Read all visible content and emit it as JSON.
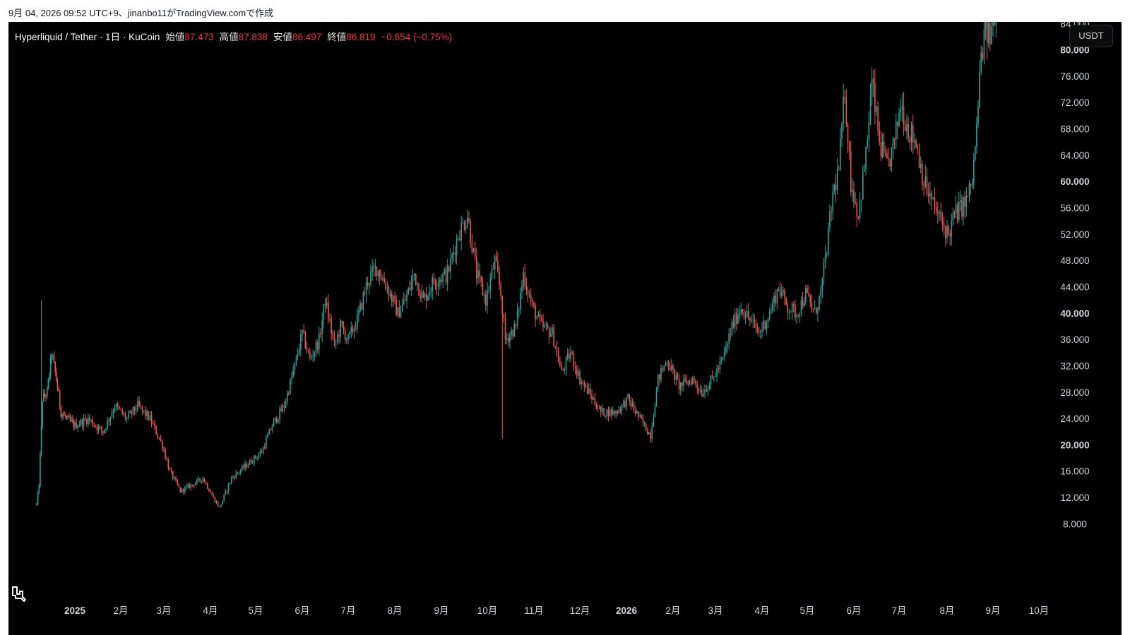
{
  "caption": "9月 04, 2026 09:52 UTC+9、jinanbo11がTradingView.comで作成",
  "legend": {
    "symbol": "Hyperliquid / Tether · 1日 · KuCoin",
    "open_label": "始値",
    "open": "87.473",
    "high_label": "高値",
    "high": "87.838",
    "low_label": "安値",
    "low": "86.497",
    "close_label": "終値",
    "close": "86.819",
    "change": "−0.654 (−0.75%)"
  },
  "currency_button": "USDT",
  "logo": "tradingview-logo-icon",
  "colors": {
    "background": "#000000",
    "up": "#26a69a",
    "down": "#ef5350",
    "last_price": "#f23645",
    "axis_text": "#d1d4dc"
  },
  "chart_data": {
    "type": "candlestick",
    "title": "Hyperliquid / Tether · 1日 · KuCoin",
    "y_ticks": [
      "84.000",
      "80.000",
      "76.000",
      "72.000",
      "68.000",
      "64.000",
      "60.000",
      "56.000",
      "52.000",
      "48.000",
      "44.000",
      "40.000",
      "36.000",
      "32.000",
      "28.000",
      "24.000",
      "20.000",
      "16.000",
      "12.000",
      "8.000"
    ],
    "y_ticks_bold": [
      "80.000",
      "60.000",
      "40.000",
      "20.000"
    ],
    "x_ticks": [
      "2025",
      "2月",
      "3月",
      "4月",
      "5月",
      "6月",
      "7月",
      "8月",
      "9月",
      "10月",
      "11月",
      "12月",
      "2026",
      "2月",
      "3月",
      "4月",
      "5月",
      "6月",
      "7月",
      "8月",
      "9月",
      "10月"
    ],
    "x_ticks_bold": [
      "2025",
      "2026"
    ],
    "ylim": [
      5.1,
      89.3
    ],
    "last_price": "86.819",
    "approx_path": [
      {
        "date": "2024-11-29",
        "price": 11
      },
      {
        "date": "2024-12-01",
        "price": 14
      },
      {
        "date": "2024-12-04",
        "price": 27
      },
      {
        "date": "2024-12-08",
        "price": 28
      },
      {
        "date": "2024-12-12",
        "price": 34
      },
      {
        "date": "2024-12-16",
        "price": 30
      },
      {
        "date": "2024-12-20",
        "price": 25
      },
      {
        "date": "2024-12-25",
        "price": 24
      },
      {
        "date": "2025-01-01",
        "price": 23
      },
      {
        "date": "2025-01-10",
        "price": 24
      },
      {
        "date": "2025-01-20",
        "price": 22
      },
      {
        "date": "2025-01-28",
        "price": 26
      },
      {
        "date": "2025-02-05",
        "price": 24
      },
      {
        "date": "2025-02-12",
        "price": 26
      },
      {
        "date": "2025-02-20",
        "price": 24
      },
      {
        "date": "2025-02-28",
        "price": 20
      },
      {
        "date": "2025-03-05",
        "price": 16
      },
      {
        "date": "2025-03-12",
        "price": 13
      },
      {
        "date": "2025-03-20",
        "price": 14
      },
      {
        "date": "2025-03-27",
        "price": 15
      },
      {
        "date": "2025-04-03",
        "price": 12
      },
      {
        "date": "2025-04-07",
        "price": 10.5
      },
      {
        "date": "2025-04-15",
        "price": 15
      },
      {
        "date": "2025-04-25",
        "price": 17
      },
      {
        "date": "2025-05-05",
        "price": 19
      },
      {
        "date": "2025-05-12",
        "price": 23
      },
      {
        "date": "2025-05-20",
        "price": 26
      },
      {
        "date": "2025-05-27",
        "price": 32
      },
      {
        "date": "2025-06-01",
        "price": 37
      },
      {
        "date": "2025-06-06",
        "price": 33
      },
      {
        "date": "2025-06-12",
        "price": 36
      },
      {
        "date": "2025-06-16",
        "price": 42
      },
      {
        "date": "2025-06-22",
        "price": 35
      },
      {
        "date": "2025-06-26",
        "price": 38
      },
      {
        "date": "2025-07-01",
        "price": 36
      },
      {
        "date": "2025-07-07",
        "price": 39
      },
      {
        "date": "2025-07-14",
        "price": 45
      },
      {
        "date": "2025-07-20",
        "price": 47
      },
      {
        "date": "2025-07-27",
        "price": 44
      },
      {
        "date": "2025-08-03",
        "price": 40
      },
      {
        "date": "2025-08-08",
        "price": 42
      },
      {
        "date": "2025-08-14",
        "price": 46
      },
      {
        "date": "2025-08-20",
        "price": 42
      },
      {
        "date": "2025-08-27",
        "price": 45
      },
      {
        "date": "2025-09-05",
        "price": 46
      },
      {
        "date": "2025-09-12",
        "price": 52
      },
      {
        "date": "2025-09-18",
        "price": 55
      },
      {
        "date": "2025-09-24",
        "price": 46
      },
      {
        "date": "2025-09-30",
        "price": 42
      },
      {
        "date": "2025-10-06",
        "price": 48
      },
      {
        "date": "2025-10-10",
        "price": 43
      },
      {
        "date": "2025-10-13",
        "price": 36
      },
      {
        "date": "2025-10-20",
        "price": 38
      },
      {
        "date": "2025-10-25",
        "price": 46
      },
      {
        "date": "2025-10-31",
        "price": 41
      },
      {
        "date": "2025-11-06",
        "price": 38
      },
      {
        "date": "2025-11-13",
        "price": 37
      },
      {
        "date": "2025-11-19",
        "price": 31
      },
      {
        "date": "2025-11-25",
        "price": 34
      },
      {
        "date": "2025-12-01",
        "price": 30
      },
      {
        "date": "2025-12-07",
        "price": 28
      },
      {
        "date": "2025-12-15",
        "price": 25
      },
      {
        "date": "2025-12-25",
        "price": 25
      },
      {
        "date": "2026-01-02",
        "price": 27
      },
      {
        "date": "2026-01-10",
        "price": 24
      },
      {
        "date": "2026-01-17",
        "price": 21.5
      },
      {
        "date": "2026-01-22",
        "price": 30
      },
      {
        "date": "2026-01-28",
        "price": 33
      },
      {
        "date": "2026-02-05",
        "price": 29
      },
      {
        "date": "2026-02-14",
        "price": 30
      },
      {
        "date": "2026-02-20",
        "price": 28
      },
      {
        "date": "2026-02-27",
        "price": 30
      },
      {
        "date": "2026-03-06",
        "price": 33
      },
      {
        "date": "2026-03-12",
        "price": 38
      },
      {
        "date": "2026-03-18",
        "price": 41
      },
      {
        "date": "2026-03-24",
        "price": 39
      },
      {
        "date": "2026-03-30",
        "price": 37
      },
      {
        "date": "2026-04-06",
        "price": 40
      },
      {
        "date": "2026-04-12",
        "price": 44
      },
      {
        "date": "2026-04-18",
        "price": 41
      },
      {
        "date": "2026-04-24",
        "price": 40
      },
      {
        "date": "2026-04-30",
        "price": 43
      },
      {
        "date": "2026-05-06",
        "price": 40
      },
      {
        "date": "2026-05-10",
        "price": 43
      },
      {
        "date": "2026-05-14",
        "price": 50
      },
      {
        "date": "2026-05-18",
        "price": 58
      },
      {
        "date": "2026-05-22",
        "price": 62
      },
      {
        "date": "2026-05-26",
        "price": 74
      },
      {
        "date": "2026-05-30",
        "price": 60
      },
      {
        "date": "2026-06-04",
        "price": 55
      },
      {
        "date": "2026-06-09",
        "price": 64
      },
      {
        "date": "2026-06-13",
        "price": 75
      },
      {
        "date": "2026-06-18",
        "price": 66
      },
      {
        "date": "2026-06-23",
        "price": 62
      },
      {
        "date": "2026-06-28",
        "price": 66
      },
      {
        "date": "2026-07-02",
        "price": 72
      },
      {
        "date": "2026-07-07",
        "price": 68
      },
      {
        "date": "2026-07-12",
        "price": 66
      },
      {
        "date": "2026-07-17",
        "price": 60
      },
      {
        "date": "2026-07-22",
        "price": 57
      },
      {
        "date": "2026-07-28",
        "price": 54
      },
      {
        "date": "2026-08-02",
        "price": 52
      },
      {
        "date": "2026-08-06",
        "price": 55
      },
      {
        "date": "2026-08-10",
        "price": 56
      },
      {
        "date": "2026-08-14",
        "price": 57
      },
      {
        "date": "2026-08-18",
        "price": 60
      },
      {
        "date": "2026-08-21",
        "price": 68
      },
      {
        "date": "2026-08-24",
        "price": 79
      },
      {
        "date": "2026-08-27",
        "price": 83
      },
      {
        "date": "2026-08-30",
        "price": 82
      },
      {
        "date": "2026-09-02",
        "price": 86
      },
      {
        "date": "2026-09-04",
        "price": 86.819
      }
    ],
    "spikes": [
      {
        "date": "2024-12-03",
        "high": 42
      },
      {
        "date": "2025-10-11",
        "low": 21
      }
    ]
  }
}
